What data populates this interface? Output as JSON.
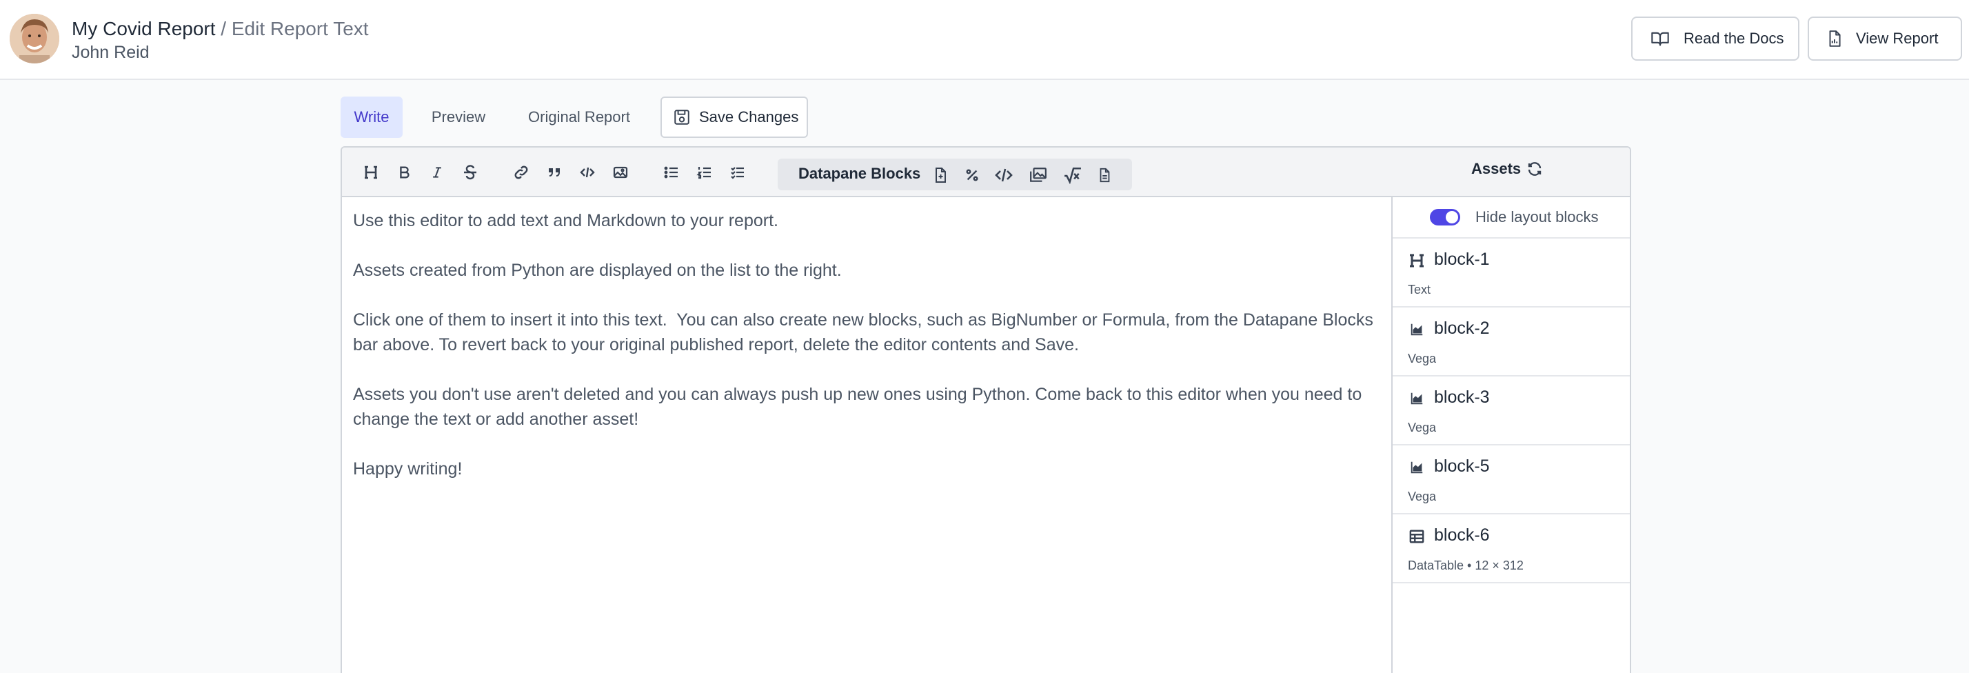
{
  "header": {
    "report_name": "My Covid Report",
    "separator": " / ",
    "page_title": "Edit Report Text",
    "user_name": "John Reid",
    "buttons": {
      "docs": "Read the Docs",
      "view": "View Report"
    }
  },
  "tabs": {
    "write": "Write",
    "preview": "Preview",
    "original": "Original Report",
    "save": "Save Changes"
  },
  "toolbar": {
    "blocks_label": "Datapane Blocks",
    "format_icons": [
      "heading-icon",
      "bold-icon",
      "italic-icon",
      "strikethrough-icon",
      "link-icon",
      "quote-icon",
      "code-icon",
      "image-icon",
      "bullet-list-icon",
      "numbered-list-icon",
      "checklist-icon"
    ],
    "block_icons": [
      "file-plus-icon",
      "percent-icon",
      "embed-code-icon",
      "media-icon",
      "formula-icon",
      "document-icon"
    ],
    "assets_label": "Assets"
  },
  "editor": {
    "paragraphs": [
      "Use this editor to add text and Markdown to your report.",
      "Assets created from Python are displayed on the list to the right.",
      "Click one of them to insert it into this text.  You can also create new blocks, such as BigNumber or Formula, from the Datapane Blocks bar above. To revert back to your original published report, delete the editor contents and Save.",
      "Assets you don't use aren't deleted and you can always push up new ones using Python. Come back to this editor when you need to change the text or add another asset!",
      "Happy writing!"
    ]
  },
  "assets": {
    "toggle_label": "Hide layout blocks",
    "toggle_on": true,
    "items": [
      {
        "name": "block-1",
        "type": "Text",
        "icon": "heading-icon"
      },
      {
        "name": "block-2",
        "type": "Vega",
        "icon": "chart-icon"
      },
      {
        "name": "block-3",
        "type": "Vega",
        "icon": "chart-icon"
      },
      {
        "name": "block-5",
        "type": "Vega",
        "icon": "chart-icon"
      },
      {
        "name": "block-6",
        "type": "DataTable • 12 × 312",
        "icon": "table-icon"
      }
    ]
  },
  "colors": {
    "accent": "#4f46e5",
    "active_tab_bg": "#e0e7ff",
    "border": "#d1d5db"
  }
}
